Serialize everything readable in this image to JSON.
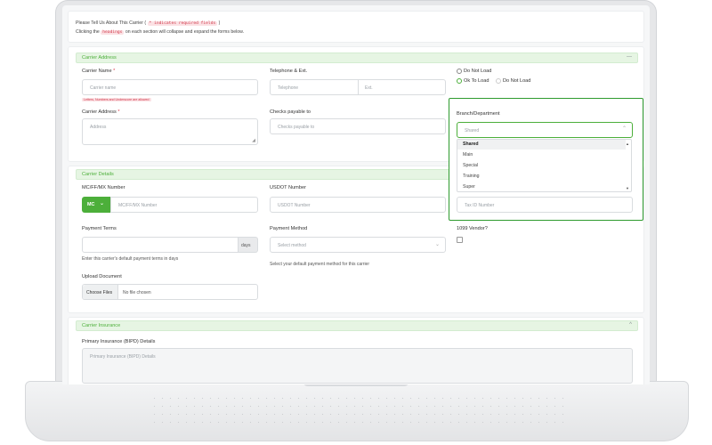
{
  "intro": {
    "line1_prefix": "Please Tell Us About This Carrier ( ",
    "line1_tag": "* indicates required fields",
    "line1_suffix": " )",
    "line2_prefix": "Clicking the ",
    "line2_tag": "headings",
    "line2_suffix": " on each section will collapse and expand the forms below."
  },
  "carrier_address": {
    "title": "Carrier Address",
    "toggle": "—",
    "carrier_name_label": "Carrier Name ",
    "carrier_name_req": "*",
    "carrier_name_placeholder": "Carrier name",
    "carrier_name_hint": "Letters, Numbers and Underscore are allowed",
    "telephone_label": "Telephone & Ext.",
    "telephone_placeholder": "Telephone",
    "ext_placeholder": "Ext.",
    "do_not_load_top": "Do Not Load",
    "ok_to_load": "Ok To Load",
    "do_not_load": "Do Not Load",
    "carrier_address_label": "Carrier Address ",
    "carrier_address_req": "*",
    "address_placeholder": "Address",
    "checks_label": "Checks payable to",
    "checks_placeholder": "Checks payable to",
    "branch_label": "Branch/Department",
    "branch_value": "Shared",
    "branch_options": [
      "Shared",
      "Main",
      "Special",
      "Training",
      "Super"
    ]
  },
  "carrier_details": {
    "title": "Carrier Details",
    "mc_label": "MC/FF/MX Number",
    "mc_button": "MC",
    "mc_placeholder": "MC/FF/MX Number",
    "usdot_label": "USDOT Number",
    "usdot_placeholder": "USDOT Number",
    "taxid_placeholder": "Tax ID Number",
    "payment_terms_label": "Payment Terms",
    "days_addon": "days",
    "payment_terms_help": "Enter this carrier's default payment terms in days",
    "payment_method_label": "Payment Method",
    "payment_method_placeholder": "Select method",
    "payment_method_help": "Select your default payment method for this carrier",
    "vendor_1099_label": "1099 Vendor?",
    "upload_label": "Upload Document",
    "choose_files": "Choose Files",
    "no_file": "No file chosen"
  },
  "carrier_insurance": {
    "title": "Carrier Insurance",
    "toggle": "^",
    "primary_label": "Primary Insurance (BIPD) Details",
    "primary_placeholder": "Primary Insurance (BIPD) Details"
  },
  "colors": {
    "accent": "#4caf3a",
    "highlight": "#2e9b2e",
    "required": "#e04050"
  }
}
